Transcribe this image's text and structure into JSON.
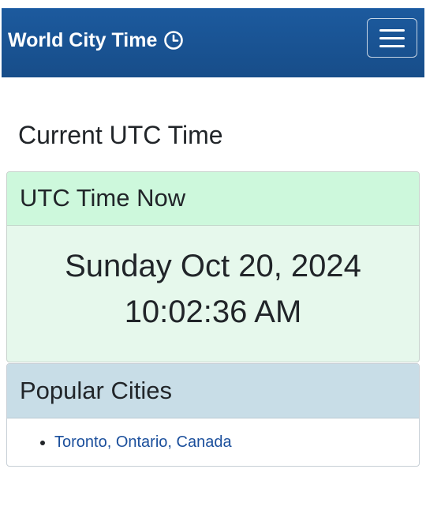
{
  "navbar": {
    "brand": "World City Time",
    "brand_icon": "clock-icon",
    "menu_icon": "hamburger-menu-icon",
    "background_color": "#174d89"
  },
  "main": {
    "title": "Current UTC Time"
  },
  "utc_card": {
    "header": "UTC Time Now",
    "date": "Sunday Oct 20, 2024",
    "time": "10:02:36 AM",
    "header_color": "#cdf8dc",
    "body_color": "#e6f8ec"
  },
  "cities_card": {
    "header": "Popular Cities",
    "header_color": "#c8dde7",
    "link_color": "#1b4f9c",
    "cities": [
      {
        "label": "Toronto, Ontario, Canada"
      }
    ]
  }
}
